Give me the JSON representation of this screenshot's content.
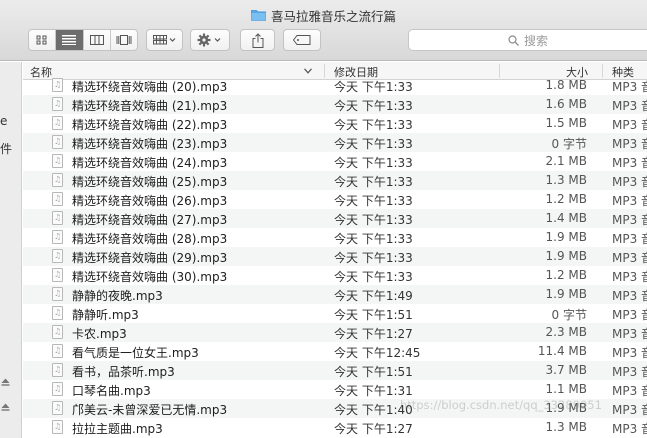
{
  "window": {
    "title": "喜马拉雅音乐之流行篇"
  },
  "search": {
    "placeholder": "搜索"
  },
  "sidebar": {
    "labels": [
      "e",
      "件"
    ]
  },
  "columns": {
    "name": "名称",
    "date": "修改日期",
    "size": "大小",
    "kind": "种类"
  },
  "files": [
    {
      "name": "精选环绕音效嗨曲 (20).mp3",
      "date": "今天 下午1:33",
      "size": "1.8 MB",
      "kind": "MP3 音"
    },
    {
      "name": "精选环绕音效嗨曲 (21).mp3",
      "date": "今天 下午1:33",
      "size": "1.6 MB",
      "kind": "MP3 音"
    },
    {
      "name": "精选环绕音效嗨曲 (22).mp3",
      "date": "今天 下午1:33",
      "size": "1.5 MB",
      "kind": "MP3 音"
    },
    {
      "name": "精选环绕音效嗨曲 (23).mp3",
      "date": "今天 下午1:33",
      "size": "0 字节",
      "kind": "MP3 音"
    },
    {
      "name": "精选环绕音效嗨曲 (24).mp3",
      "date": "今天 下午1:33",
      "size": "2.1 MB",
      "kind": "MP3 音"
    },
    {
      "name": "精选环绕音效嗨曲 (25).mp3",
      "date": "今天 下午1:33",
      "size": "1.3 MB",
      "kind": "MP3 音"
    },
    {
      "name": "精选环绕音效嗨曲 (26).mp3",
      "date": "今天 下午1:33",
      "size": "1.2 MB",
      "kind": "MP3 音"
    },
    {
      "name": "精选环绕音效嗨曲 (27).mp3",
      "date": "今天 下午1:33",
      "size": "1.4 MB",
      "kind": "MP3 音"
    },
    {
      "name": "精选环绕音效嗨曲 (28).mp3",
      "date": "今天 下午1:33",
      "size": "1.9 MB",
      "kind": "MP3 音"
    },
    {
      "name": "精选环绕音效嗨曲 (29).mp3",
      "date": "今天 下午1:33",
      "size": "1.9 MB",
      "kind": "MP3 音"
    },
    {
      "name": "精选环绕音效嗨曲 (30).mp3",
      "date": "今天 下午1:33",
      "size": "1.2 MB",
      "kind": "MP3 音"
    },
    {
      "name": "静静的夜晚.mp3",
      "date": "今天 下午1:49",
      "size": "1.9 MB",
      "kind": "MP3 音"
    },
    {
      "name": "静静听.mp3",
      "date": "今天 下午1:51",
      "size": "0 字节",
      "kind": "MP3 音"
    },
    {
      "name": "卡农.mp3",
      "date": "今天 下午1:27",
      "size": "2.3 MB",
      "kind": "MP3 音"
    },
    {
      "name": "看气质是一位女王.mp3",
      "date": "今天 下午12:45",
      "size": "11.4 MB",
      "kind": "MP3 音"
    },
    {
      "name": "看书，品茶听.mp3",
      "date": "今天 下午1:51",
      "size": "3.7 MB",
      "kind": "MP3 音"
    },
    {
      "name": "口琴名曲.mp3",
      "date": "今天 下午1:31",
      "size": "1.1 MB",
      "kind": "MP3 音"
    },
    {
      "name": "邝美云-未曾深爱已无情.mp3",
      "date": "今天 下午1:40",
      "size": "1.9 MB",
      "kind": "MP3 音"
    },
    {
      "name": "拉拉主题曲.mp3",
      "date": "今天 下午1:27",
      "size": "1.3 MB",
      "kind": "MP3 音"
    }
  ],
  "watermark": "https://blog.csdn.net/qq_33289051"
}
